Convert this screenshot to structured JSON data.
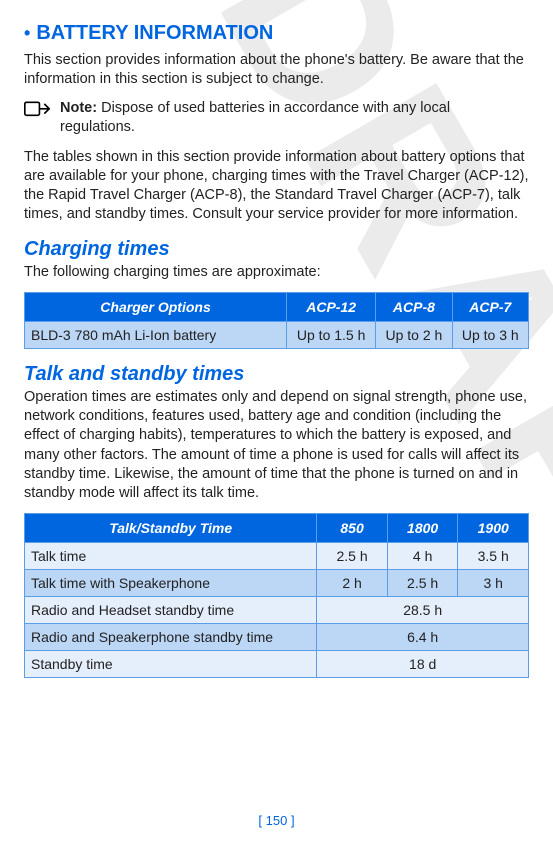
{
  "watermark": "DRAFT",
  "section": {
    "bullet": "•",
    "title": "BATTERY INFORMATION",
    "intro": "This section provides information about the phone's battery. Be aware that the information in this section is subject to change.",
    "note_label": "Note:",
    "note_text": " Dispose of used batteries in accordance with any local regulations.",
    "tables_intro": "The tables shown in this section provide information about battery options that are available for your phone, charging times with the Travel Charger (ACP-12), the Rapid Travel Charger (ACP-8), the Standard Travel Charger (ACP-7), talk times, and standby times. Consult your service provider for more information."
  },
  "charging": {
    "heading": "Charging times",
    "intro": "The following charging times are approximate:",
    "headers": [
      "Charger Options",
      "ACP-12",
      "ACP-8",
      "ACP-7"
    ],
    "row_label": "BLD-3 780 mAh Li-Ion battery",
    "row_vals": [
      "Up to 1.5 h",
      "Up to 2 h",
      "Up to 3 h"
    ]
  },
  "talk": {
    "heading": "Talk and standby times",
    "intro": "Operation times are estimates only and depend on signal strength, phone use, network conditions, features used, battery age and condition (including the effect of charging habits), temperatures to which the battery is exposed, and many other factors. The amount of time a phone is used for calls will affect its standby time. Likewise, the amount of time that the phone is turned on and in standby mode will affect its talk time.",
    "headers": [
      "Talk/Standby Time",
      "850",
      "1800",
      "1900"
    ],
    "rows": [
      {
        "label": "Talk time",
        "vals": [
          "2.5 h",
          "4 h",
          "3.5 h"
        ],
        "shade": "light"
      },
      {
        "label": "Talk time with Speakerphone",
        "vals": [
          "2 h",
          "2.5 h",
          "3 h"
        ],
        "shade": "blue"
      },
      {
        "label": "Radio and Headset standby time",
        "merged": "28.5 h",
        "shade": "light"
      },
      {
        "label": "Radio and Speakerphone standby time",
        "merged": "6.4 h",
        "shade": "blue"
      },
      {
        "label": "Standby time",
        "merged": "18 d",
        "shade": "light"
      }
    ]
  },
  "page_number": "[ 150 ]",
  "chart_data": [
    {
      "type": "table",
      "title": "Charging times",
      "columns": [
        "Charger Options",
        "ACP-12",
        "ACP-8",
        "ACP-7"
      ],
      "rows": [
        [
          "BLD-3 780 mAh Li-Ion battery",
          "Up to 1.5 h",
          "Up to 2 h",
          "Up to 3 h"
        ]
      ]
    },
    {
      "type": "table",
      "title": "Talk and standby times",
      "columns": [
        "Talk/Standby Time",
        "850",
        "1800",
        "1900"
      ],
      "rows": [
        [
          "Talk time",
          "2.5 h",
          "4 h",
          "3.5 h"
        ],
        [
          "Talk time with Speakerphone",
          "2 h",
          "2.5 h",
          "3 h"
        ],
        [
          "Radio and Headset standby time",
          "28.5 h",
          "28.5 h",
          "28.5 h"
        ],
        [
          "Radio and Speakerphone standby time",
          "6.4 h",
          "6.4 h",
          "6.4 h"
        ],
        [
          "Standby time",
          "18 d",
          "18 d",
          "18 d"
        ]
      ]
    }
  ]
}
